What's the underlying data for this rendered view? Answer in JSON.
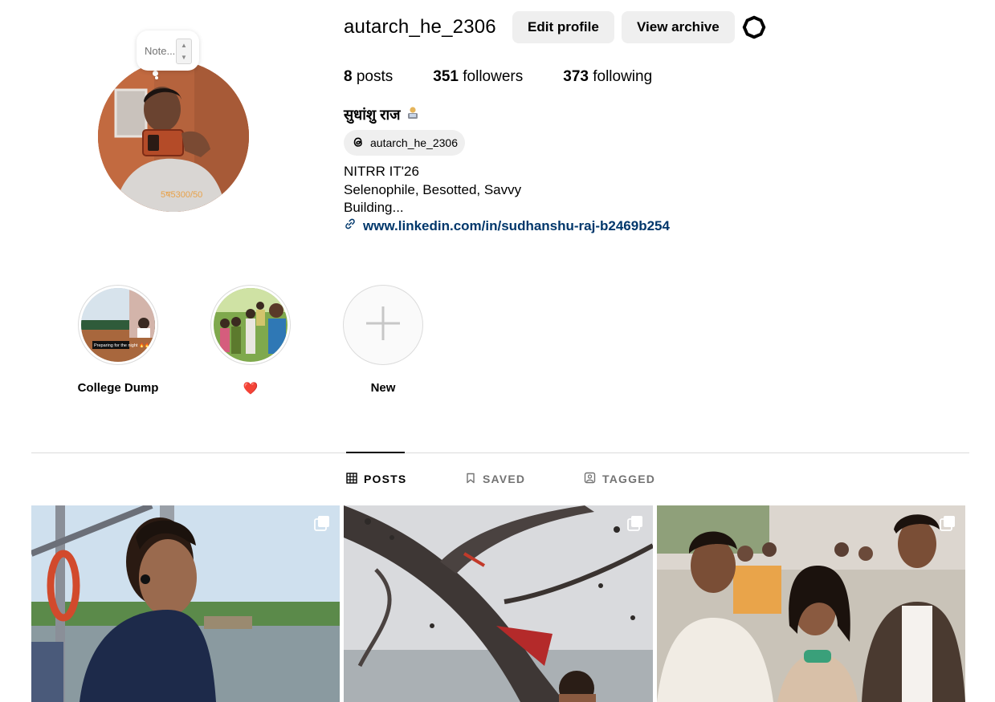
{
  "profile": {
    "username": "autarch_he_2306",
    "edit_profile_label": "Edit profile",
    "view_archive_label": "View archive",
    "note_placeholder": "Note...",
    "stats": {
      "posts_count": "8",
      "posts_label": "posts",
      "followers_count": "351",
      "followers_label": "followers",
      "following_count": "373",
      "following_label": "following"
    },
    "full_name": "सुधांशु राज",
    "threads_handle": "autarch_he_2306",
    "bio_lines": [
      "NITRR IT'26",
      "Selenophile, Besotted, Savvy",
      "Building..."
    ],
    "link": "www.linkedin.com/in/sudhanshu-raj-b2469b254",
    "avatar_overlay_text": "5ष5300/50"
  },
  "highlights": [
    {
      "label": "College Dump",
      "overlay_text": "Preparing for the night 🔥🔥"
    },
    {
      "label": "❤️"
    },
    {
      "label": "New"
    }
  ],
  "tabs": [
    {
      "label": "POSTS",
      "icon": "grid-icon",
      "active": true
    },
    {
      "label": "SAVED",
      "icon": "bookmark-icon",
      "active": false
    },
    {
      "label": "TAGGED",
      "icon": "tagged-icon",
      "active": false
    }
  ],
  "colors": {
    "link": "#00376b",
    "button_bg": "#efefef",
    "muted": "#737373",
    "divider": "#dbdbdb"
  }
}
